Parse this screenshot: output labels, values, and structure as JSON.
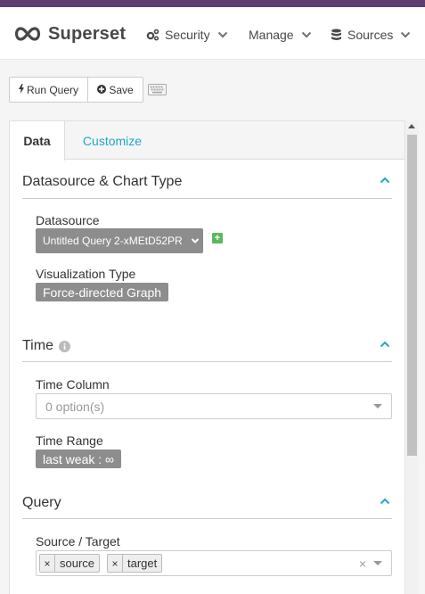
{
  "header": {
    "brand": "Superset",
    "nav": [
      {
        "label": "Security",
        "icon": "gears-icon"
      },
      {
        "label": "Manage",
        "icon": ""
      },
      {
        "label": "Sources",
        "icon": "database-icon"
      }
    ]
  },
  "toolbar": {
    "run_query_label": "Run Query",
    "save_label": "Save"
  },
  "tabs": [
    {
      "label": "Data",
      "active": true
    },
    {
      "label": "Customize",
      "active": false
    }
  ],
  "sections": {
    "datasource": {
      "title": "Datasource & Chart Type",
      "datasource_label": "Datasource",
      "datasource_value": "Untitled Query 2-xMEtD52PR",
      "viz_label": "Visualization Type",
      "viz_value": "Force-directed Graph"
    },
    "time": {
      "title": "Time",
      "time_column_label": "Time Column",
      "time_column_placeholder": "0 option(s)",
      "time_range_label": "Time Range",
      "time_range_value": "last weak : ∞"
    },
    "query": {
      "title": "Query",
      "source_target_label": "Source / Target",
      "chips": [
        "source",
        "target"
      ]
    }
  },
  "colors": {
    "accent": "#20a7c9",
    "topstrip": "#5f3f73",
    "tag_bg": "#8d8d8d",
    "add_green": "#5cb85c"
  }
}
